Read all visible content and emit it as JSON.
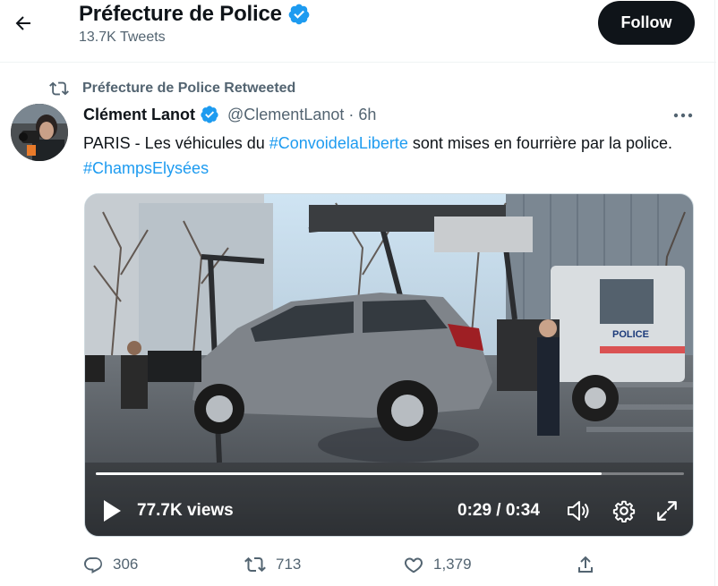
{
  "header": {
    "title": "Préfecture de Police",
    "subtitle": "13.7K Tweets",
    "follow_label": "Follow"
  },
  "retweet": {
    "label": "Préfecture de Police Retweeted"
  },
  "tweet": {
    "author": "Clément Lanot",
    "handle": "@ClementLanot",
    "separator": "·",
    "time": "6h",
    "text_part1": "PARIS - Les véhicules du ",
    "hashtag1": "#ConvoidelaLiberte",
    "text_part2": " sont mises en fourrière par la police. ",
    "hashtag2": "#ChampsElysées"
  },
  "video": {
    "views": "77.7K views",
    "time": "0:29 / 0:34",
    "progress": 0.86,
    "truck_label": "POLICE"
  },
  "actions": {
    "replies": "306",
    "retweets": "713",
    "likes": "1,379"
  },
  "colors": {
    "accent": "#1d9bf0",
    "text": "#0f1419",
    "secondary": "#536471",
    "verified": "#1d9bf0"
  },
  "icons": {
    "back": "arrow-left-icon",
    "verified": "verified-badge-icon",
    "retweet": "retweet-icon",
    "more": "more-horizontal-icon",
    "play": "play-icon",
    "volume": "volume-icon",
    "settings": "gear-icon",
    "fullscreen": "fullscreen-icon",
    "reply": "reply-icon",
    "like": "heart-icon",
    "share": "share-icon"
  }
}
